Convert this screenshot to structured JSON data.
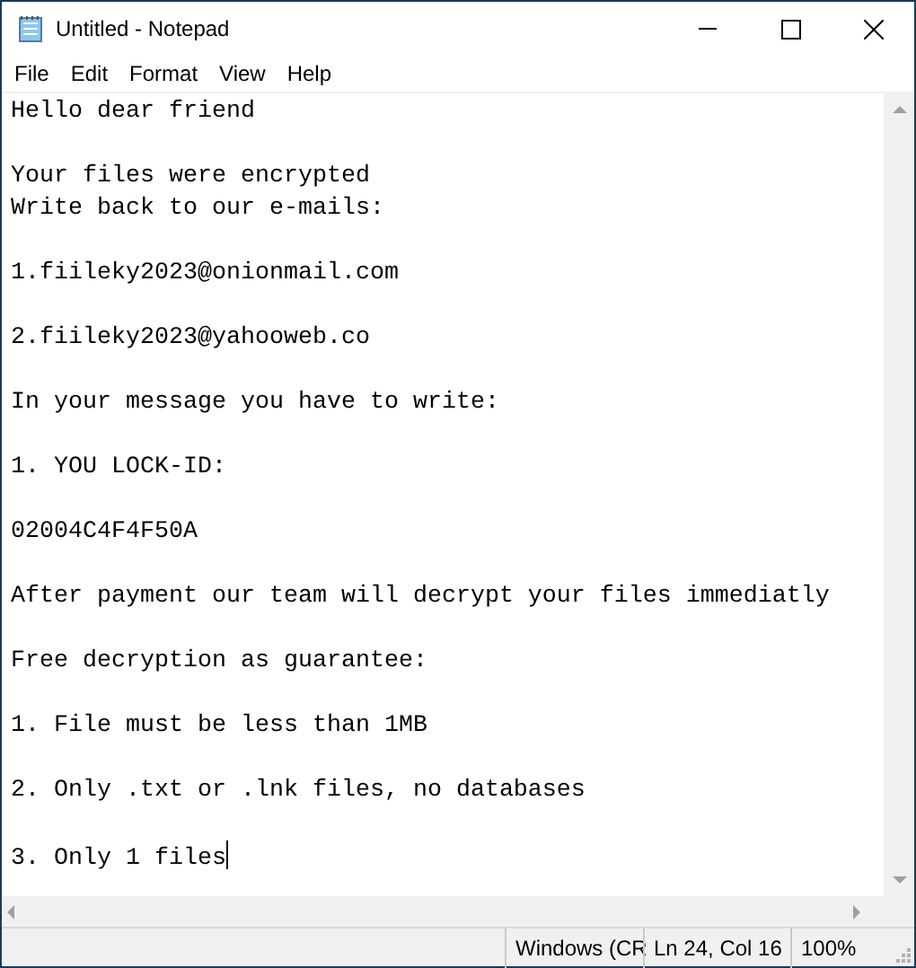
{
  "window": {
    "title": "Untitled - Notepad"
  },
  "menu": [
    "File",
    "Edit",
    "Format",
    "View",
    "Help"
  ],
  "document": {
    "paragraphs": [
      [
        "Hello dear friend"
      ],
      [
        "Your files were encrypted",
        "Write back to our e-mails:"
      ],
      [
        "1.fiileky2023@onionmail.com"
      ],
      [
        "2.fiileky2023@yahooweb.co"
      ],
      [
        "In your message you have to write:"
      ],
      [
        "1. YOU LOCK-ID:"
      ],
      [
        "02004C4F4F50A"
      ],
      [
        "After payment our team will decrypt your files immediatly"
      ],
      [
        "Free decryption as guarantee:"
      ],
      [
        "1. File must be less than 1MB"
      ],
      [
        "2. Only .txt or .lnk files, no databases"
      ],
      [
        "3. Only 1 files"
      ]
    ]
  },
  "status_bar": [
    "Windows (CR",
    "Ln 24, Col 16",
    "100%"
  ]
}
